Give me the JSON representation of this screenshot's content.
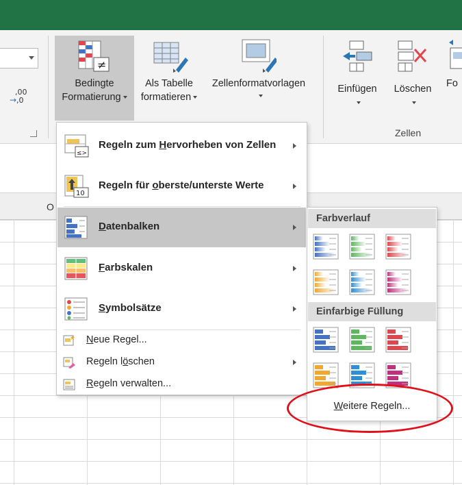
{
  "ribbon": {
    "bedingte_line1": "Bedingte",
    "bedingte_line2": "Formatierung",
    "tabelle_line1": "Als Tabelle",
    "tabelle_line2": "formatieren",
    "zellformat": "Zellenformatvorlagen",
    "einfuegen": "Einfügen",
    "loeschen": "Löschen",
    "format_partial": "Fo",
    "zellen_group": "Zellen",
    "dec_top": ",00",
    "dec_bottom": ",0"
  },
  "grid": {
    "column_letter": "O"
  },
  "menu": {
    "items": [
      {
        "pre": "Regeln zum ",
        "key": "H",
        "post": "ervorheben von Zellen",
        "icon": "highlight-cells-icon",
        "submenu": true
      },
      {
        "pre": "Regeln für ",
        "key": "o",
        "post": "berste/unterste Werte",
        "icon": "top-bottom-icon",
        "submenu": true
      },
      {
        "pre": "",
        "key": "D",
        "post": "atenbalken",
        "icon": "data-bars-icon",
        "submenu": true
      },
      {
        "pre": "",
        "key": "F",
        "post": "arbskalen",
        "icon": "color-scales-icon",
        "submenu": true
      },
      {
        "pre": "",
        "key": "S",
        "post": "ymbolsätze",
        "icon": "icon-sets-icon",
        "submenu": true
      }
    ],
    "small_items": [
      {
        "pre": "",
        "key": "N",
        "post": "eue Regel...",
        "icon": "new-rule-icon",
        "submenu": false
      },
      {
        "pre": "Regeln l",
        "key": "ö",
        "post": "schen",
        "icon": "clear-rules-icon",
        "submenu": true
      },
      {
        "pre": "",
        "key": "R",
        "post": "egeln verwalten...",
        "icon": "manage-rules-icon",
        "submenu": false
      }
    ],
    "top_value_icon_text": "10",
    "ne_symbol": "≠",
    "le_symbol": "≤>"
  },
  "submenu": {
    "gradient_header": "Farbverlauf",
    "solid_header": "Einfarbige Füllung",
    "more_pre": "",
    "more_key": "W",
    "more_post": "eitere Regeln...",
    "colors": [
      "#4472c4",
      "#5cb85c",
      "#e0474c",
      "#f0a830",
      "#2e8fd6",
      "#c0307f"
    ]
  },
  "colors": {
    "title_bar": "#217346",
    "highlight": "#e0101a"
  }
}
